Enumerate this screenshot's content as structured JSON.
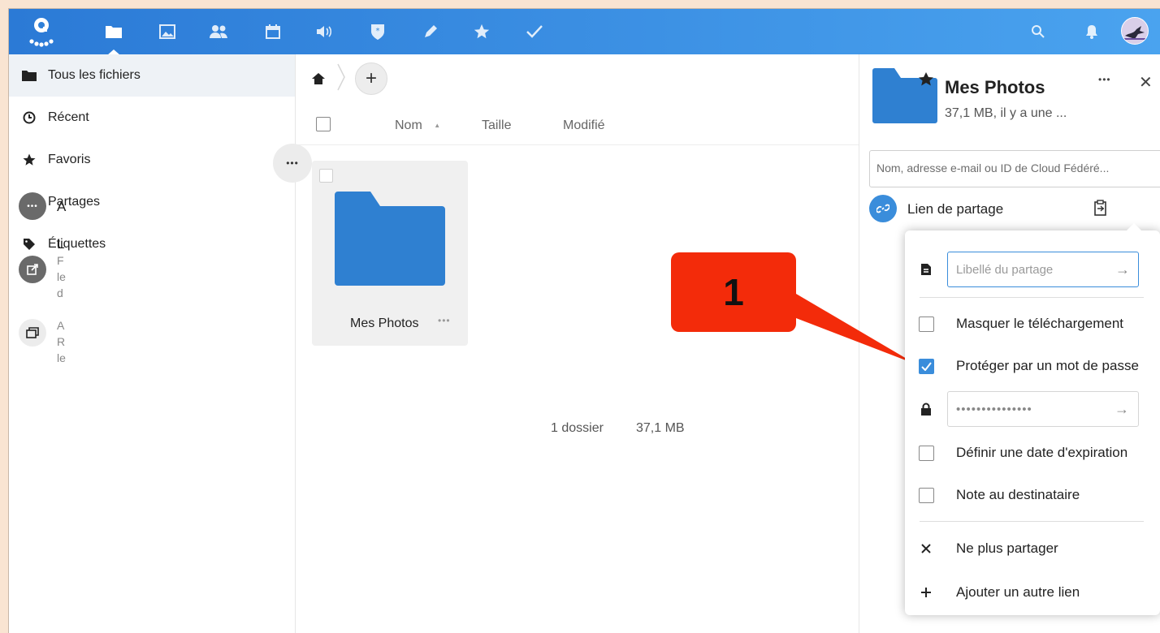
{
  "nav": {
    "icons": [
      "files-icon",
      "photos-icon",
      "contacts-icon",
      "calendar-icon",
      "audio-icon",
      "passwords-icon",
      "notes-icon",
      "bookmarks-icon",
      "tasks-icon"
    ],
    "accent": "#3a8ddb"
  },
  "sidebar": {
    "items": [
      {
        "label": "Tous les fichiers"
      },
      {
        "label": "Récent"
      },
      {
        "label": "Favoris"
      },
      {
        "label": "Partages"
      },
      {
        "label": "Étiquettes"
      }
    ]
  },
  "files": {
    "columns": {
      "name": "Nom",
      "size": "Taille",
      "modified": "Modifié",
      "sort_indicator": "▲"
    },
    "items": [
      {
        "name": "Mes Photos",
        "menu": "•••"
      }
    ],
    "summary": {
      "count": "1 dossier",
      "size": "37,1 MB"
    }
  },
  "details": {
    "title": "Mes Photos",
    "subtitle": "37,1 MB, il y a une ...",
    "menu": "•••",
    "close": "✕",
    "share_placeholder": "Nom, adresse e-mail ou ID de Cloud Fédéré...",
    "link_label": "Lien de partage",
    "more": "•••",
    "partial_a": "A",
    "partial_l": "L",
    "partial_f": "F",
    "partial_le": "le",
    "partial_d": "d",
    "partial_a2": "A",
    "partial_r": "R",
    "partial_le2": "le"
  },
  "popover": {
    "label_placeholder": "Libellé du partage",
    "hide_download": "Masquer le téléchargement",
    "password_protect": "Protéger par un mot de passe",
    "password_checked": true,
    "password_value": "•••••••••••••••",
    "expiration": "Définir une date d'expiration",
    "note": "Note au destinataire",
    "unshare": "Ne plus partager",
    "add_link": "Ajouter un autre lien"
  },
  "callout": {
    "label": "1",
    "color": "#f32b0a"
  }
}
